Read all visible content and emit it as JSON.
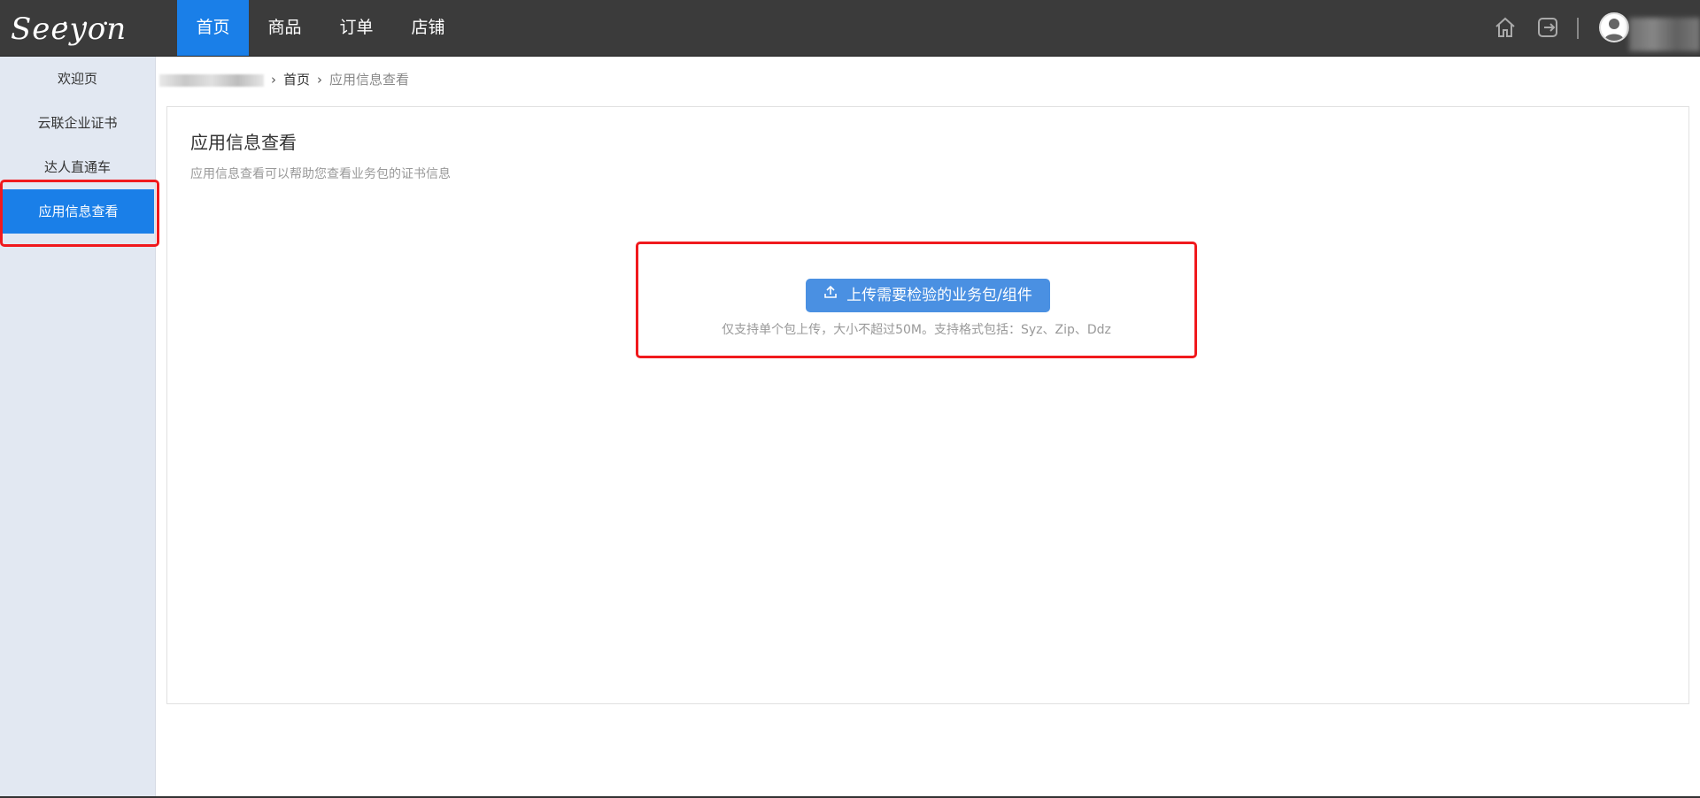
{
  "brand": {
    "logo_text": "Seeyon"
  },
  "top_nav": {
    "tabs": [
      {
        "label": "首页",
        "active": true
      },
      {
        "label": "商品",
        "active": false
      },
      {
        "label": "订单",
        "active": false
      },
      {
        "label": "店铺",
        "active": false
      }
    ],
    "icons": [
      "home-icon",
      "logout-icon",
      "avatar-icon"
    ]
  },
  "sidebar": {
    "items": [
      {
        "label": "欢迎页",
        "active": false
      },
      {
        "label": "云联企业证书",
        "active": false
      },
      {
        "label": "达人直通车",
        "active": false
      },
      {
        "label": "应用信息查看",
        "active": true
      }
    ]
  },
  "breadcrumb": {
    "home": "首页",
    "current": "应用信息查看"
  },
  "main": {
    "title": "应用信息查看",
    "description": "应用信息查看可以帮助您查看业务包的证书信息",
    "upload_button": "上传需要检验的业务包/组件",
    "upload_hint": "仅支持单个包上传，大小不超过50M。支持格式包括：Syz、Zip、Ddz"
  },
  "colors": {
    "topbar": "#3b3b3b",
    "accent": "#1a7fe8",
    "upload_button": "#4a90e2",
    "highlight_box": "#f0191d",
    "sidebar_bg": "#e2e8f2"
  }
}
